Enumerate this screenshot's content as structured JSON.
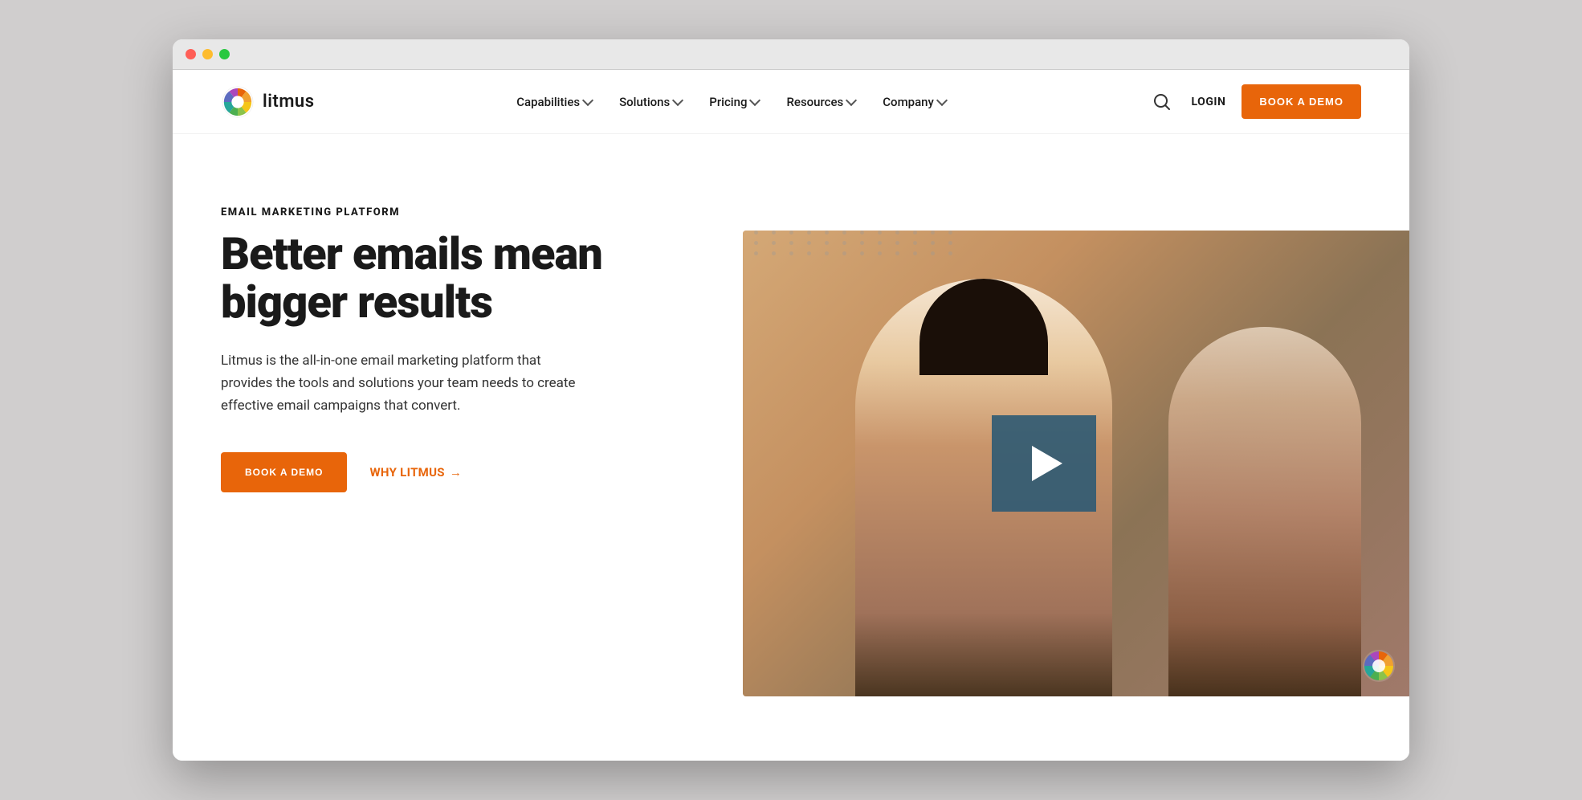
{
  "browser": {
    "dots": [
      "red",
      "yellow",
      "green"
    ]
  },
  "nav": {
    "logo_text": "litmus",
    "items": [
      {
        "label": "Capabilities",
        "has_chevron": true
      },
      {
        "label": "Solutions",
        "has_chevron": true
      },
      {
        "label": "Pricing",
        "has_chevron": true
      },
      {
        "label": "Resources",
        "has_chevron": true
      },
      {
        "label": "Company",
        "has_chevron": true
      }
    ],
    "login_label": "LOGIN",
    "book_demo_label": "BOOK A DEMO"
  },
  "hero": {
    "eyebrow": "EMAIL MARKETING PLATFORM",
    "headline": "Better emails mean bigger results",
    "body": "Litmus is the all-in-one email marketing platform that provides the tools and solutions your team needs to create effective email campaigns that convert.",
    "book_demo_label": "BOOK A DEMO",
    "why_litmus_label": "WHY LITMUS",
    "why_litmus_arrow": "→"
  },
  "colors": {
    "orange": "#e8650a",
    "dark": "#1a1a1a",
    "teal_play": "rgba(45,90,115,0.9)"
  }
}
